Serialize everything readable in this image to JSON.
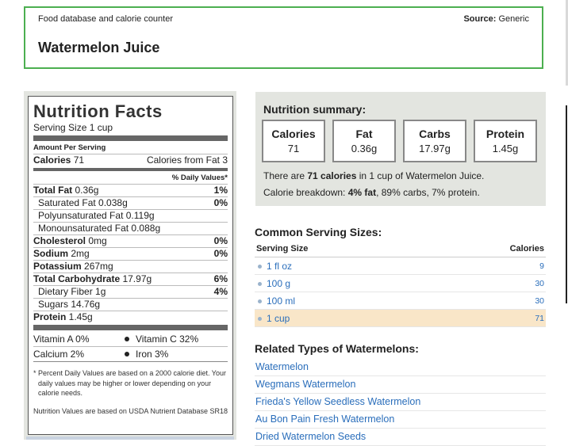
{
  "header": {
    "breadcrumb": "Food database and calorie counter",
    "source_label": "Source:",
    "source_value": "Generic",
    "title": "Watermelon Juice"
  },
  "nutrition_facts": {
    "title": "Nutrition Facts",
    "serving_size": "Serving Size 1 cup",
    "amount_per_serving": "Amount Per Serving",
    "calories_label": "Calories",
    "calories_value": "71",
    "calories_from_fat": "Calories from Fat 3",
    "daily_value_header": "% Daily Values*",
    "rows": [
      {
        "label": "Total Fat",
        "amount": "0.36g",
        "dv": "1%",
        "bold": true,
        "indent": false
      },
      {
        "label": "Saturated Fat",
        "amount": "0.038g",
        "dv": "0%",
        "bold": false,
        "indent": true
      },
      {
        "label": "Polyunsaturated Fat",
        "amount": "0.119g",
        "dv": "",
        "bold": false,
        "indent": true
      },
      {
        "label": "Monounsaturated Fat",
        "amount": "0.088g",
        "dv": "",
        "bold": false,
        "indent": true
      },
      {
        "label": "Cholesterol",
        "amount": "0mg",
        "dv": "0%",
        "bold": true,
        "indent": false
      },
      {
        "label": "Sodium",
        "amount": "2mg",
        "dv": "0%",
        "bold": true,
        "indent": false
      },
      {
        "label": "Potassium",
        "amount": "267mg",
        "dv": "",
        "bold": true,
        "indent": false
      },
      {
        "label": "Total Carbohydrate",
        "amount": "17.97g",
        "dv": "6%",
        "bold": true,
        "indent": false
      },
      {
        "label": "Dietary Fiber",
        "amount": "1g",
        "dv": "4%",
        "bold": false,
        "indent": true
      },
      {
        "label": "Sugars",
        "amount": "14.76g",
        "dv": "",
        "bold": false,
        "indent": true
      },
      {
        "label": "Protein",
        "amount": "1.45g",
        "dv": "",
        "bold": true,
        "indent": false
      }
    ],
    "vitamins": [
      {
        "left": "Vitamin A 0%",
        "right": "Vitamin C 32%"
      },
      {
        "left": "Calcium 2%",
        "right": "Iron 3%"
      }
    ],
    "footnote": "* Percent Daily Values are based on a 2000 calorie diet. Your daily values may be higher or lower depending on your calorie needs.",
    "source_note": "Nutrition Values are based on USDA Nutrient Database SR18"
  },
  "summary": {
    "heading": "Nutrition summary:",
    "boxes": [
      {
        "label": "Calories",
        "value": "71"
      },
      {
        "label": "Fat",
        "value": "0.36g"
      },
      {
        "label": "Carbs",
        "value": "17.97g"
      },
      {
        "label": "Protein",
        "value": "1.45g"
      }
    ],
    "line1_pre": "There are ",
    "line1_bold": "71 calories",
    "line1_post": " in 1 cup of Watermelon Juice.",
    "line2_pre": "Calorie breakdown: ",
    "line2_bold": "4% fat",
    "line2_post": ", 89% carbs, 7% protein."
  },
  "servings": {
    "heading": "Common Serving Sizes:",
    "col_size": "Serving Size",
    "col_calories": "Calories",
    "rows": [
      {
        "size": "1 fl oz",
        "calories": "9",
        "selected": false
      },
      {
        "size": "100 g",
        "calories": "30",
        "selected": false
      },
      {
        "size": "100 ml",
        "calories": "30",
        "selected": false
      },
      {
        "size": "1 cup",
        "calories": "71",
        "selected": true
      }
    ]
  },
  "related": {
    "heading": "Related Types of Watermelons:",
    "items": [
      "Watermelon",
      "Wegmans Watermelon",
      "Frieda's Yellow Seedless Watermelon",
      "Au Bon Pain Fresh Watermelon",
      "Dried Watermelon Seeds"
    ]
  },
  "colors": {
    "header_border": "#4caf50",
    "panel_bg": "#e3e5e0",
    "link": "#2a6ebb",
    "selected_row": "#f9e6c8"
  }
}
